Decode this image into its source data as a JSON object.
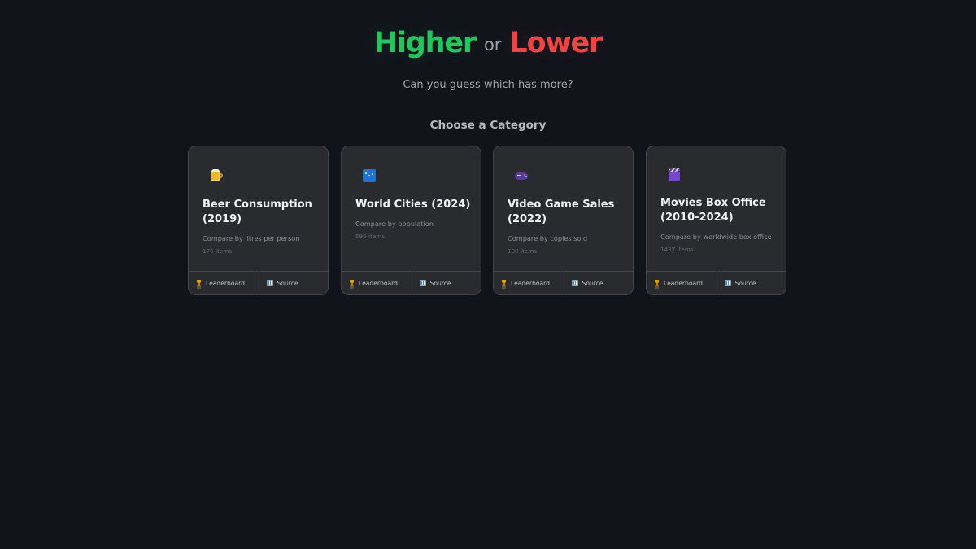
{
  "header": {
    "higher": "Higher",
    "or": "or",
    "lower": "Lower",
    "subtitle": "Can you guess which has more?"
  },
  "section": {
    "title": "Choose a Category"
  },
  "colors": {
    "background": "#12141c",
    "higher": "#22c55e",
    "lower": "#ef4444",
    "card": "#2a2b2f",
    "card_border": "#45464d"
  },
  "categories": [
    {
      "icon": "beer-mug-icon",
      "title": "Beer Consumption (2019)",
      "description": "Compare by litres per person",
      "count": "176 items",
      "leaderboard_label": "Leaderboard",
      "source_label": "Source"
    },
    {
      "icon": "world-cities-icon",
      "title": "World Cities (2024)",
      "description": "Compare by population",
      "count": "596 items",
      "leaderboard_label": "Leaderboard",
      "source_label": "Source"
    },
    {
      "icon": "gamepad-icon",
      "title": "Video Game Sales (2022)",
      "description": "Compare by copies sold",
      "count": "100 items",
      "leaderboard_label": "Leaderboard",
      "source_label": "Source"
    },
    {
      "icon": "clapper-board-icon",
      "title": "Movies Box Office (2010-2024)",
      "description": "Compare by worldwide box office",
      "count": "1437 items",
      "leaderboard_label": "Leaderboard",
      "source_label": "Source"
    }
  ]
}
